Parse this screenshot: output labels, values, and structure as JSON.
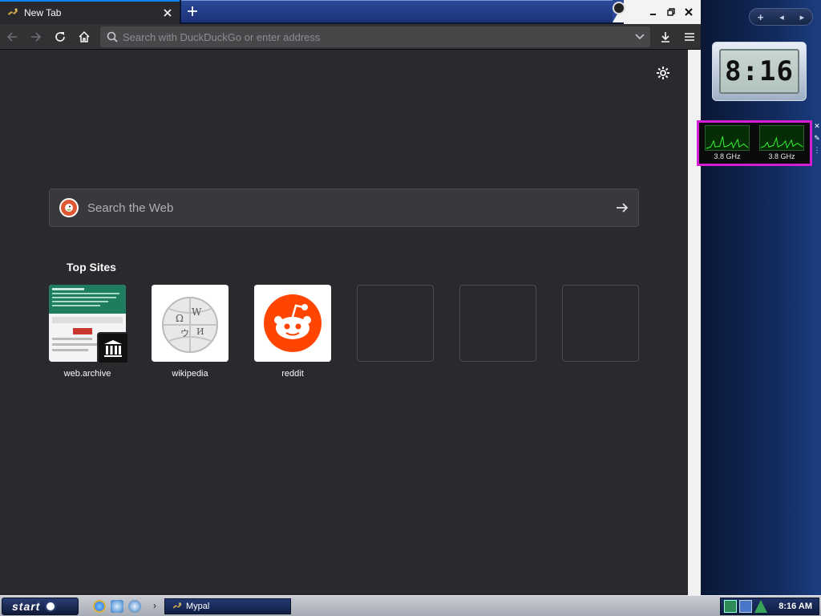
{
  "browser": {
    "tab": {
      "title": "New Tab"
    },
    "urlbar": {
      "placeholder": "Search with DuckDuckGo or enter address"
    },
    "newtab": {
      "search": {
        "placeholder": "Search the Web"
      },
      "top_sites": {
        "heading": "Top Sites",
        "tiles": [
          {
            "label": "web.archive"
          },
          {
            "label": "wikipedia"
          },
          {
            "label": "reddit"
          },
          {
            "label": ""
          },
          {
            "label": ""
          },
          {
            "label": ""
          }
        ]
      }
    }
  },
  "sidebar": {
    "clock": {
      "time": "8:16"
    },
    "cpu_meter": {
      "core1": "3.8 GHz",
      "core2": "3.8 GHz"
    }
  },
  "taskbar": {
    "start_label": "start",
    "task": {
      "label": "Mypal"
    },
    "tray": {
      "time": "8:16 AM"
    }
  },
  "colors": {
    "accent": "#0a84ff",
    "highlight": "#d31ed3",
    "reddit": "#ff4500",
    "ddg": "#de5833"
  }
}
